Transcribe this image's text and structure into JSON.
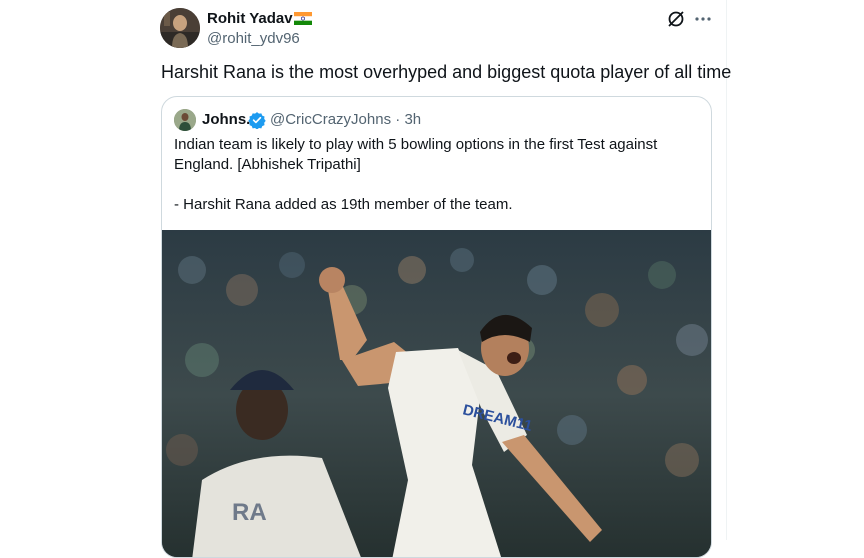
{
  "tweet": {
    "author_name": "Rohit Yadav",
    "author_handle": "@rohit_ydv96",
    "text": "Harshit Rana is the most overhyped and biggest quota player of all time",
    "flag_icon": "india-flag-icon",
    "grok_icon": "grok-icon",
    "more_icon": "more-icon"
  },
  "quote": {
    "author_name": "Johns.",
    "verified_icon": "verified-badge-icon",
    "author_handle": "@CricCrazyJohns",
    "separator": "·",
    "time": "3h",
    "text_line1": "Indian team is likely to play with 5 bowling options in the first Test against England. [Abhishek Tripathi]",
    "text_line2": "- Harshit Rana added as 19th member of the team.",
    "media": {
      "jersey_text": "DREAM11",
      "back_jersey_text": "RA"
    }
  },
  "colors": {
    "text": "#0f1419",
    "secondary": "#536471",
    "border": "#cfd9de",
    "verified": "#1d9bf0"
  }
}
